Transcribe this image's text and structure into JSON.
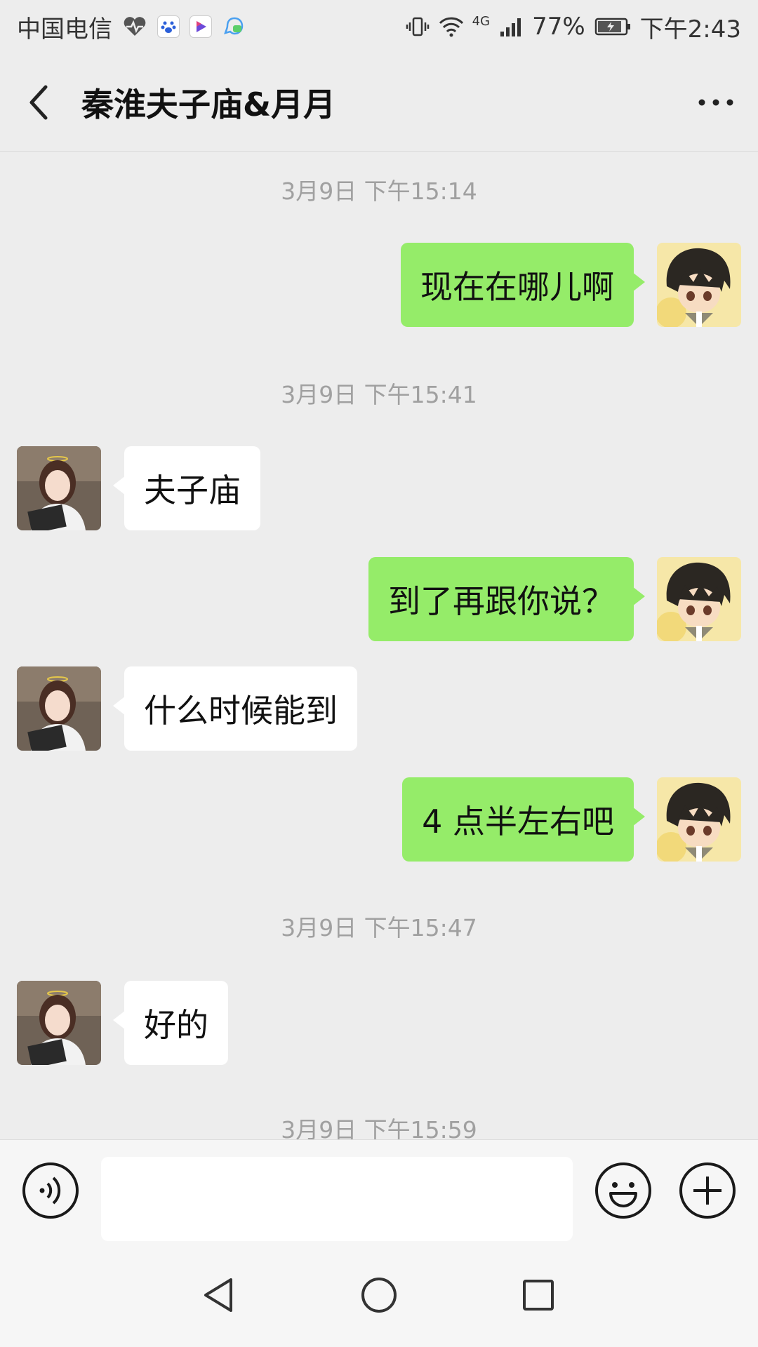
{
  "status_bar": {
    "carrier": "中国电信",
    "network": "4G",
    "battery": "77%",
    "time": "下午2:43",
    "icons": [
      "heart-monitor-icon",
      "baidu-icon",
      "video-app-icon",
      "chat-app-icon",
      "vibrate-icon",
      "wifi-icon",
      "signal-icon",
      "battery-icon"
    ]
  },
  "header": {
    "title": "秦淮夫子庙&月月",
    "back_icon": "back-chevron-icon",
    "more_icon": "more-dots-icon"
  },
  "messages": [
    {
      "type": "time",
      "text": "3月9日 下午15:14"
    },
    {
      "type": "msg",
      "side": "right",
      "text": "现在在哪儿啊"
    },
    {
      "type": "time",
      "text": "3月9日 下午15:41"
    },
    {
      "type": "msg",
      "side": "left",
      "text": "夫子庙"
    },
    {
      "type": "msg",
      "side": "right",
      "text": "到了再跟你说？"
    },
    {
      "type": "msg",
      "side": "left",
      "text": "什么时候能到"
    },
    {
      "type": "msg",
      "side": "right",
      "text": "4 点半左右吧"
    },
    {
      "type": "time",
      "text": "3月9日 下午15:47"
    },
    {
      "type": "msg",
      "side": "left",
      "text": "好的"
    },
    {
      "type": "time",
      "text": "3月9日 下午15:59"
    }
  ],
  "input_bar": {
    "placeholder": "",
    "value": "",
    "voice_icon": "voice-icon",
    "emoji_icon": "emoji-icon",
    "plus_icon": "plus-icon"
  },
  "nav_bar": {
    "icons": [
      "nav-back-icon",
      "nav-home-icon",
      "nav-recent-icon"
    ]
  },
  "colors": {
    "background": "#ededed",
    "own_bubble": "#95ec69",
    "other_bubble": "#ffffff",
    "timestamp": "#a0a0a0"
  }
}
